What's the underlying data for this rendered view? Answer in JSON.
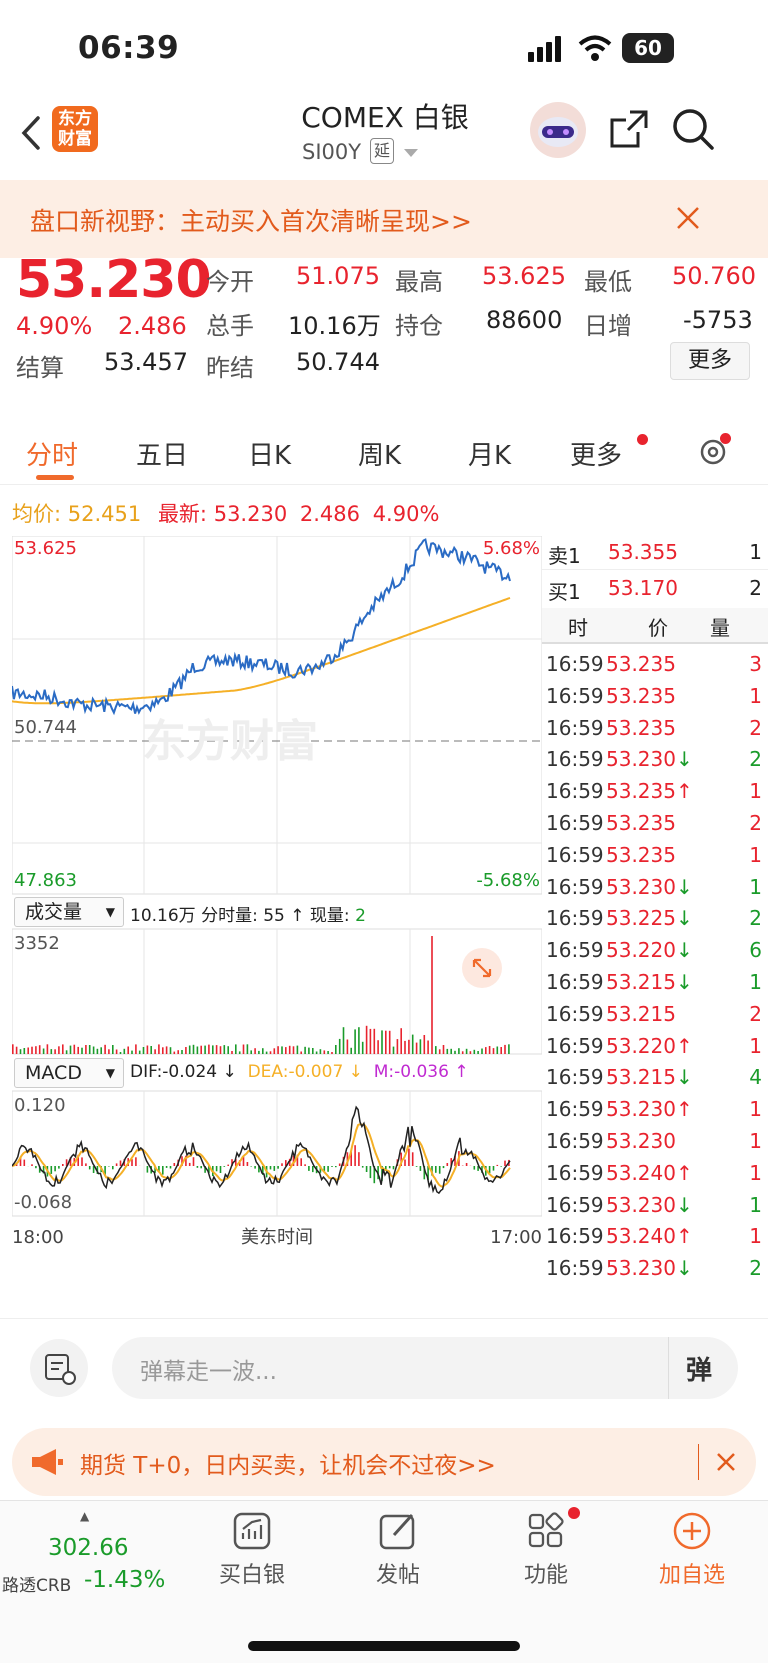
{
  "status": {
    "time": "06:39",
    "battery": "60"
  },
  "header": {
    "title": "COMEX 白银",
    "code": "SI00Y",
    "delay_tag": "延",
    "logo_text": "东方财富"
  },
  "banner": {
    "text": "盘口新视野：主动买入首次清晰呈现>>"
  },
  "quote": {
    "price": "53.230",
    "pct": "4.90%",
    "change": "2.486",
    "open_label": "今开",
    "open": "51.075",
    "high_label": "最高",
    "high": "53.625",
    "low_label": "最低",
    "low": "50.760",
    "volume_label": "总手",
    "volume": "10.16万",
    "oi_label": "持仓",
    "oi": "88600",
    "daily_inc_label": "日增",
    "daily_inc": "-5753",
    "settle_label": "结算",
    "settle": "53.457",
    "prev_settle_label": "昨结",
    "prev_settle": "50.744",
    "more_button": "更多"
  },
  "tabs": [
    "分时",
    "五日",
    "日K",
    "周K",
    "月K",
    "更多"
  ],
  "summary": {
    "avg_label": "均价:",
    "avg": "52.451",
    "latest_label": "最新:",
    "latest": "53.230",
    "chg": "2.486",
    "pct": "4.90%"
  },
  "chart": {
    "y_top": "53.625",
    "y_top_pct": "5.68%",
    "y_mid": "50.744",
    "y_bottom": "47.863",
    "y_bottom_pct": "-5.68%",
    "watermark": "东方财富",
    "vol_selector": "成交量",
    "vol_info_total": "10.16万",
    "vol_info_label": "分时量:",
    "vol_info_val": "55",
    "vol_info_cur_label": "现量:",
    "vol_info_cur": "2",
    "vol_max": "3352",
    "macd_selector": "MACD",
    "dif": "DIF:-0.024 ↓",
    "dea": "DEA:-0.007 ↓",
    "m": "M:-0.036 ↑",
    "macd_top": "0.120",
    "macd_bottom": "-0.068",
    "x_start": "18:00",
    "x_mid": "美东时间",
    "x_end": "17:00"
  },
  "book": {
    "ask_label": "卖1",
    "ask": "53.355",
    "ask_qty": "1",
    "bid_label": "买1",
    "bid": "53.170",
    "bid_qty": "2",
    "col_time": "时",
    "col_price": "价",
    "col_qty": "量"
  },
  "trades": [
    {
      "t": "16:59",
      "p": "53.235",
      "a": "",
      "q": "3"
    },
    {
      "t": "16:59",
      "p": "53.235",
      "a": "",
      "q": "1"
    },
    {
      "t": "16:59",
      "p": "53.235",
      "a": "",
      "q": "2"
    },
    {
      "t": "16:59",
      "p": "53.230",
      "a": "↓",
      "q": "2"
    },
    {
      "t": "16:59",
      "p": "53.235",
      "a": "↑",
      "q": "1"
    },
    {
      "t": "16:59",
      "p": "53.235",
      "a": "",
      "q": "2"
    },
    {
      "t": "16:59",
      "p": "53.235",
      "a": "",
      "q": "1"
    },
    {
      "t": "16:59",
      "p": "53.230",
      "a": "↓",
      "q": "1"
    },
    {
      "t": "16:59",
      "p": "53.225",
      "a": "↓",
      "q": "2"
    },
    {
      "t": "16:59",
      "p": "53.220",
      "a": "↓",
      "q": "6"
    },
    {
      "t": "16:59",
      "p": "53.215",
      "a": "↓",
      "q": "1"
    },
    {
      "t": "16:59",
      "p": "53.215",
      "a": "",
      "q": "2"
    },
    {
      "t": "16:59",
      "p": "53.220",
      "a": "↑",
      "q": "1"
    },
    {
      "t": "16:59",
      "p": "53.215",
      "a": "↓",
      "q": "4"
    },
    {
      "t": "16:59",
      "p": "53.230",
      "a": "↑",
      "q": "1"
    },
    {
      "t": "16:59",
      "p": "53.230",
      "a": "",
      "q": "1"
    },
    {
      "t": "16:59",
      "p": "53.240",
      "a": "↑",
      "q": "1"
    },
    {
      "t": "16:59",
      "p": "53.230",
      "a": "↓",
      "q": "1"
    },
    {
      "t": "16:59",
      "p": "53.240",
      "a": "↑",
      "q": "1"
    },
    {
      "t": "16:59",
      "p": "53.230",
      "a": "↓",
      "q": "2"
    }
  ],
  "input": {
    "placeholder": "弹幕走一波...",
    "send": "弹"
  },
  "ad": {
    "text": "期货 T+0，日内买卖，让机会不过夜>>"
  },
  "bottom": {
    "crb_value": "302.66",
    "crb_label": "路透CRB",
    "crb_pct": "-1.43%",
    "buy": "买白银",
    "post": "发帖",
    "func": "功能",
    "add": "加自选"
  },
  "colors": {
    "up": "#e8232e",
    "down": "#1a9b2a",
    "price_line": "#2a6bc4",
    "avg_line": "#f5b027",
    "accent": "#f06a2c"
  }
}
